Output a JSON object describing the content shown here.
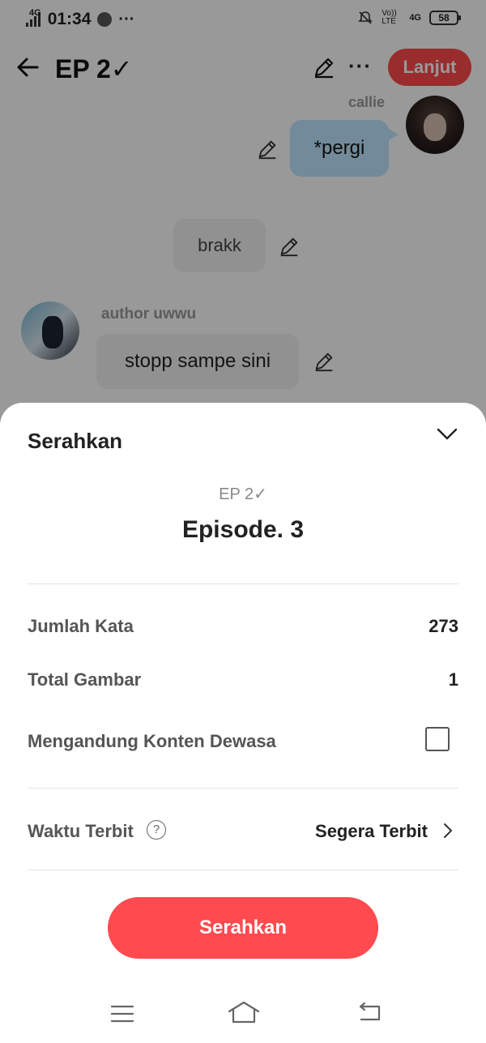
{
  "status_bar": {
    "network": "4G",
    "time": "01:34",
    "volte": "Vo)) LTE",
    "network_right": "4G",
    "battery": "58"
  },
  "header": {
    "title": "EP 2✓",
    "next_label": "Lanjut"
  },
  "chat": {
    "messages": [
      {
        "sender": "callie",
        "text": "*pergi",
        "side": "right"
      },
      {
        "sender": "",
        "text": "brakk",
        "side": "center"
      },
      {
        "sender": "author uwwu",
        "text": "stopp sampe sini",
        "side": "left"
      }
    ]
  },
  "sheet": {
    "title": "Serahkan",
    "episode_current": "EP 2✓",
    "episode_next": "Episode. 3",
    "word_count_label": "Jumlah Kata",
    "word_count_value": "273",
    "image_count_label": "Total Gambar",
    "image_count_value": "1",
    "adult_content_label": "Mengandung Konten Dewasa",
    "adult_content_checked": false,
    "publish_time_label": "Waktu Terbit",
    "publish_time_value": "Segera Terbit",
    "help_symbol": "?",
    "submit_label": "Serahkan"
  },
  "colors": {
    "accent": "#ff4a4f",
    "bubble_right": "#bfe6ff",
    "bubble_neutral": "#f2f2f2"
  },
  "icons": [
    "back-arrow-icon",
    "pencil-icon",
    "more-icon",
    "chevron-down-icon",
    "help-icon",
    "chevron-right-icon",
    "menu-icon",
    "home-icon",
    "back-nav-icon"
  ]
}
